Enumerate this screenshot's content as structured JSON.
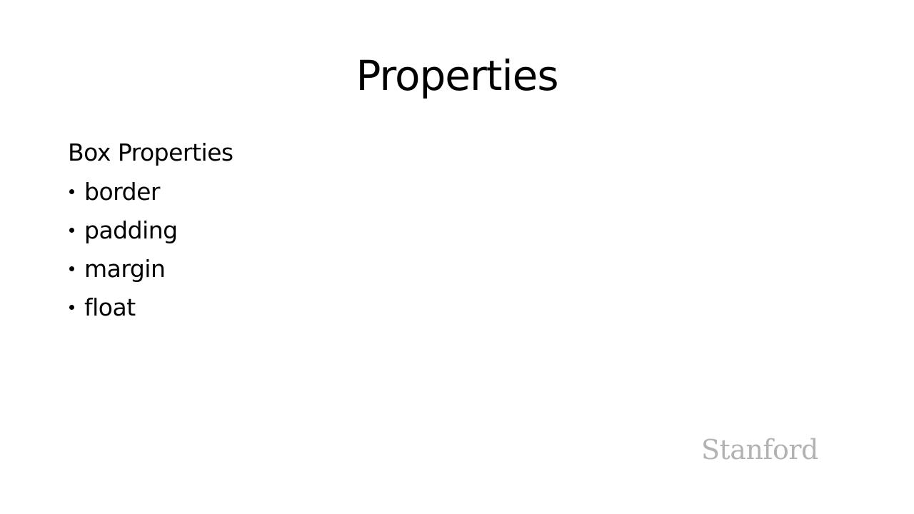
{
  "slide": {
    "title": "Properties",
    "heading": "Box Properties",
    "bullets": [
      "border",
      "padding",
      "margin",
      "float"
    ],
    "logo_text": "Stanford"
  },
  "colors": {
    "background": "#ffffff",
    "text": "#000000",
    "logo": "#b2b2b2"
  }
}
